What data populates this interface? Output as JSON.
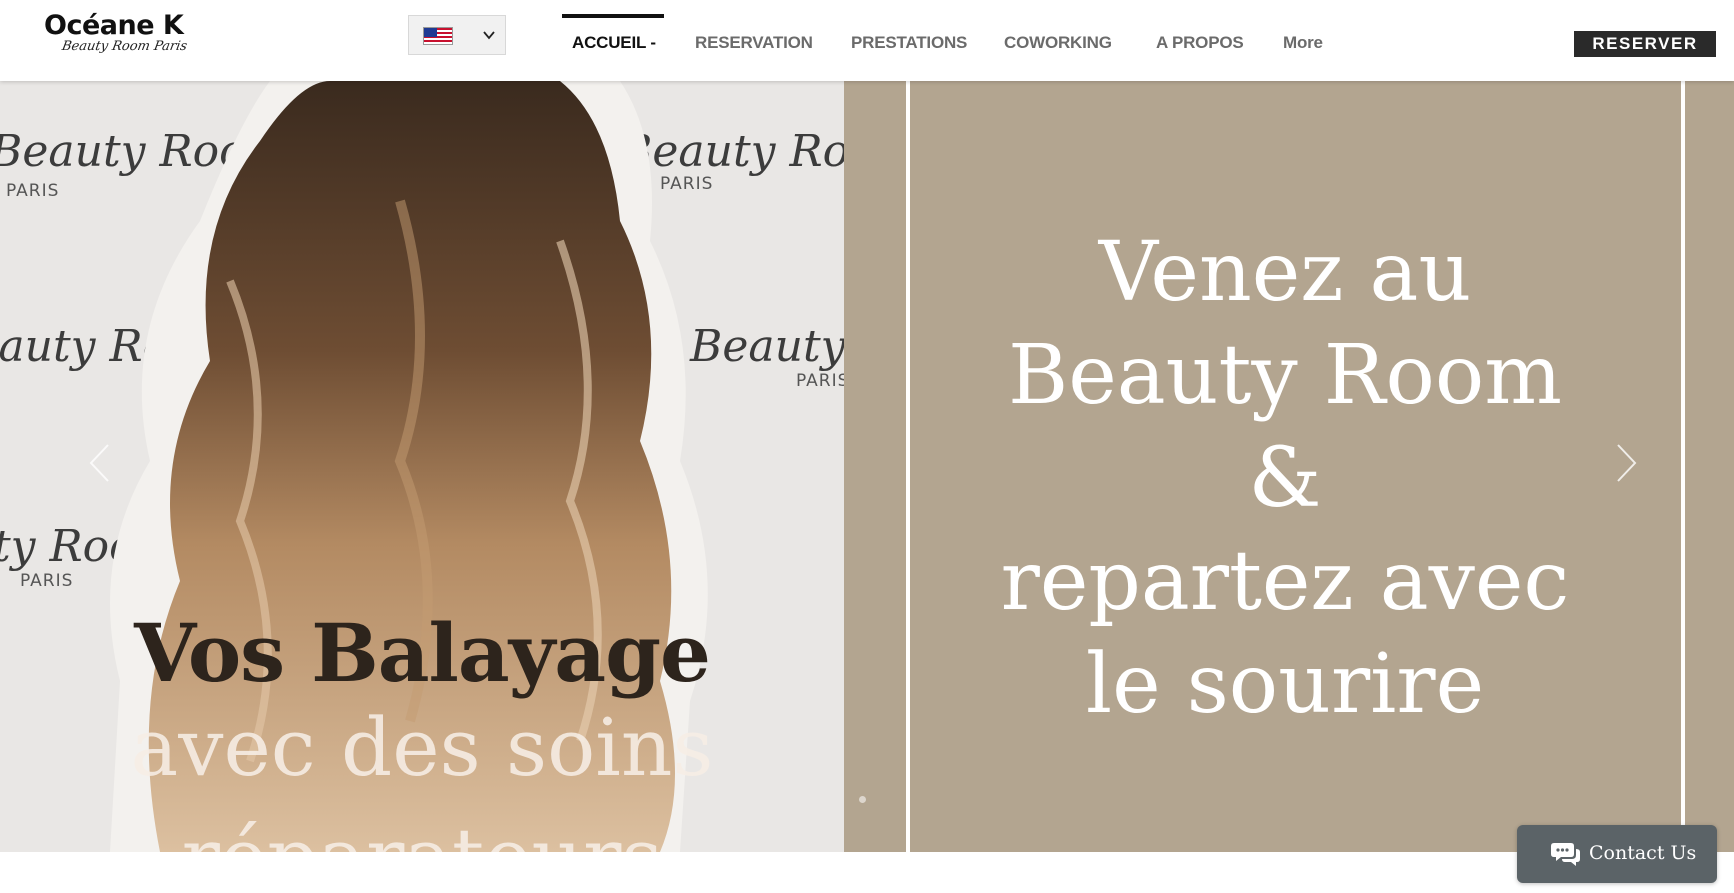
{
  "header": {
    "logo": {
      "name": "Océane K",
      "tagline": "Beauty Room Paris"
    },
    "language": {
      "selected_icon": "us-flag-icon"
    },
    "nav": [
      {
        "label": "ACCUEIL -",
        "active": true
      },
      {
        "label": "RESERVATION",
        "active": false
      },
      {
        "label": "PRESTATIONS",
        "active": false
      },
      {
        "label": "COWORKING",
        "active": false
      },
      {
        "label": "A PROPOS",
        "active": false
      },
      {
        "label": "More",
        "active": false
      }
    ],
    "cta_label": "RESERVER"
  },
  "hero": {
    "photo_backdrop": {
      "brand_word": "Beauty Room",
      "city_word": "PARIS"
    },
    "photo_title": "Vos Balayage",
    "photo_subtitle": "avec des soins",
    "photo_subtitle_cut": "réparateurs",
    "slide_lines": [
      "Venez au",
      "Beauty Room",
      "&",
      "repartez avec",
      "le sourire"
    ],
    "prev_icon": "chevron-left-icon",
    "next_icon": "chevron-right-icon"
  },
  "chat": {
    "label": "Contact Us",
    "icon": "chat-bubbles-icon"
  },
  "colors": {
    "accent_panel": "#b3a590",
    "dark_button": "#2a2a2a",
    "chat_button": "#5b6367",
    "nav_active": "#111111",
    "nav_inactive": "#6b6b6b"
  }
}
